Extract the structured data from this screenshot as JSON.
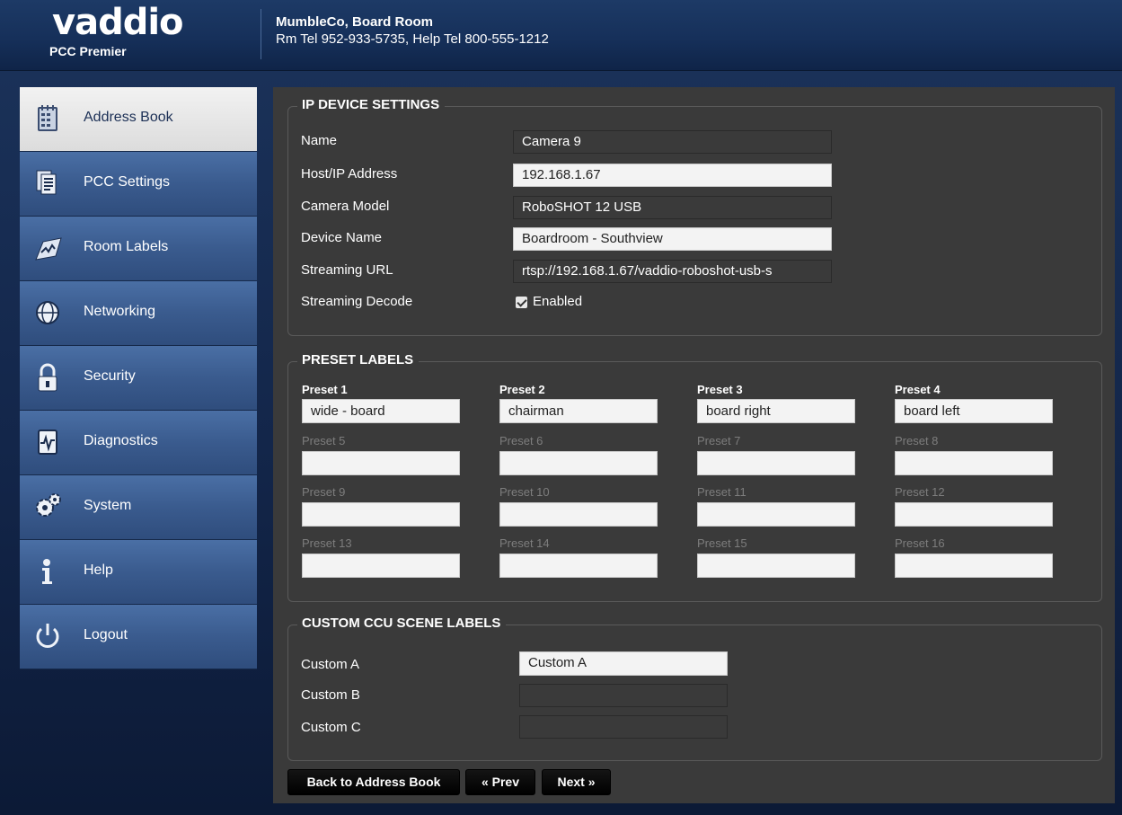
{
  "header": {
    "logo_word": "vaddio",
    "logo_sub": "PCC Premier",
    "room_name": "MumbleCo, Board Room",
    "phones": "Rm Tel 952-933-5735, Help Tel 800-555-1212"
  },
  "sidebar": {
    "items": [
      {
        "label": "Address Book",
        "icon": "address-book-icon",
        "active": true
      },
      {
        "label": "PCC Settings",
        "icon": "pcc-settings-icon"
      },
      {
        "label": "Room Labels",
        "icon": "room-labels-icon"
      },
      {
        "label": "Networking",
        "icon": "networking-icon"
      },
      {
        "label": "Security",
        "icon": "lock-icon"
      },
      {
        "label": "Diagnostics",
        "icon": "diagnostics-icon"
      },
      {
        "label": "System",
        "icon": "gear-icon"
      },
      {
        "label": "Help",
        "icon": "info-icon"
      },
      {
        "label": "Logout",
        "icon": "power-icon"
      }
    ]
  },
  "ip_device": {
    "title": "IP DEVICE SETTINGS",
    "name_label": "Name",
    "name_value": "Camera 9",
    "host_label": "Host/IP Address",
    "host_value": "192.168.1.67",
    "model_label": "Camera Model",
    "model_value": "RoboSHOT 12 USB",
    "device_label": "Device Name",
    "device_value": "Boardroom - Southview",
    "url_label": "Streaming URL",
    "url_value": "rtsp://192.168.1.67/vaddio-roboshot-usb-s",
    "decode_label": "Streaming Decode",
    "decode_value": "Enabled",
    "decode_checked": true
  },
  "presets": {
    "title": "PRESET LABELS",
    "items": [
      {
        "label": "Preset 1",
        "value": "wide - board"
      },
      {
        "label": "Preset 2",
        "value": "chairman"
      },
      {
        "label": "Preset 3",
        "value": "board right"
      },
      {
        "label": "Preset 4",
        "value": "board left"
      },
      {
        "label": "Preset 5",
        "value": ""
      },
      {
        "label": "Preset 6",
        "value": ""
      },
      {
        "label": "Preset 7",
        "value": ""
      },
      {
        "label": "Preset 8",
        "value": ""
      },
      {
        "label": "Preset 9",
        "value": ""
      },
      {
        "label": "Preset 10",
        "value": ""
      },
      {
        "label": "Preset 11",
        "value": ""
      },
      {
        "label": "Preset 12",
        "value": ""
      },
      {
        "label": "Preset 13",
        "value": ""
      },
      {
        "label": "Preset 14",
        "value": ""
      },
      {
        "label": "Preset 15",
        "value": ""
      },
      {
        "label": "Preset 16",
        "value": ""
      }
    ]
  },
  "ccu": {
    "title": "CUSTOM CCU SCENE LABELS",
    "a_label": "Custom A",
    "a_value": "Custom A",
    "b_label": "Custom B",
    "b_value": "",
    "c_label": "Custom C",
    "c_value": ""
  },
  "buttons": {
    "back": "Back to Address Book",
    "prev": "« Prev",
    "next": "Next »"
  }
}
